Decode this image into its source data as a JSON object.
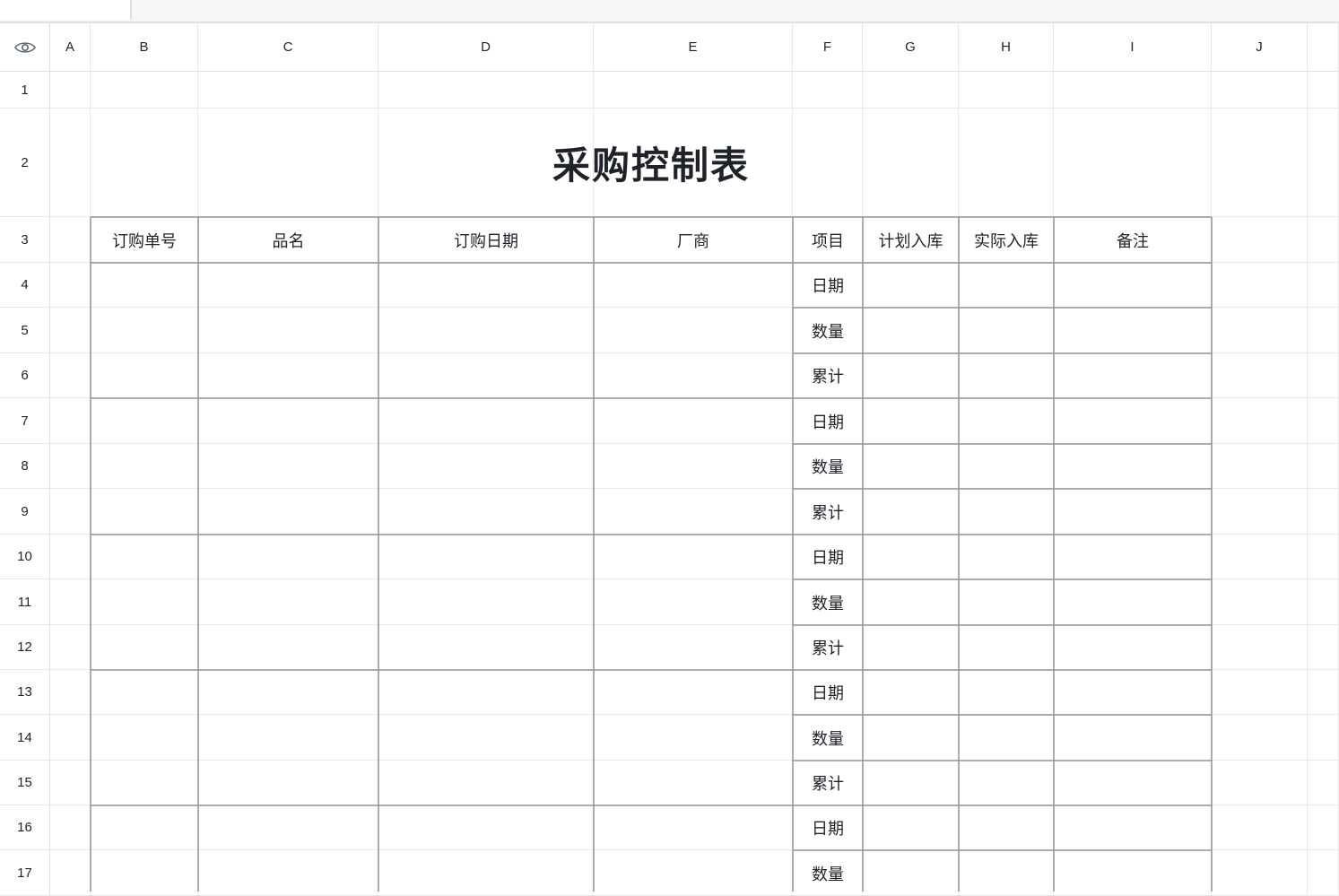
{
  "columns": [
    "A",
    "B",
    "C",
    "D",
    "E",
    "F",
    "G",
    "H",
    "I",
    "J"
  ],
  "rows": [
    "1",
    "2",
    "3",
    "4",
    "5",
    "6",
    "7",
    "8",
    "9",
    "10",
    "11",
    "12",
    "13",
    "14",
    "15",
    "16",
    "17"
  ],
  "sheet": {
    "title": "采购控制表",
    "headers": [
      "订购单号",
      "品名",
      "订购日期",
      "厂商",
      "项目",
      "计划入库",
      "实际入库",
      "备注"
    ],
    "item_labels": [
      "日期",
      "数量",
      "累计",
      "日期",
      "数量",
      "累计",
      "日期",
      "数量",
      "累计",
      "日期",
      "数量",
      "累计",
      "日期",
      "数量"
    ]
  },
  "icons": {
    "corner": "eye-icon"
  },
  "colors": {
    "table_border": "#8f959e",
    "grid": "#e9eaec",
    "header_bg": "#ffffff",
    "toolbar_bg": "#f5f6f7"
  }
}
